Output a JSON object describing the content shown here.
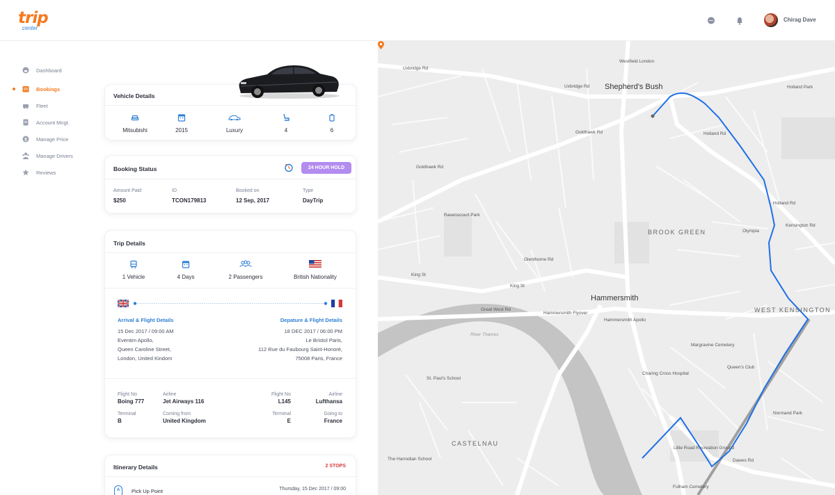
{
  "app": {
    "logo_main": "trip",
    "logo_sub": "center"
  },
  "header": {
    "user_name": "Chirag Dave",
    "icons": [
      "chat-icon",
      "bell-icon"
    ]
  },
  "sidebar": {
    "items": [
      {
        "label": "Dashboard",
        "icon": "dashboard-icon"
      },
      {
        "label": "Bookings",
        "icon": "bookings-icon",
        "active": true
      },
      {
        "label": "Fleet",
        "icon": "fleet-icon"
      },
      {
        "label": "Account Mngt.",
        "icon": "account-icon"
      },
      {
        "label": "Manage Price",
        "icon": "price-icon"
      },
      {
        "label": "Manage Drivers",
        "icon": "drivers-icon"
      },
      {
        "label": "Reviews",
        "icon": "star-icon"
      }
    ]
  },
  "vehicle": {
    "title": "Vehicle Details",
    "stats": [
      {
        "icon": "car-icon",
        "value": "Mitsubishi"
      },
      {
        "icon": "calendar-icon",
        "value": "2015"
      },
      {
        "icon": "car-type-icon",
        "value": "Luxury"
      },
      {
        "icon": "seat-icon",
        "value": "4"
      },
      {
        "icon": "luggage-icon",
        "value": "6"
      }
    ]
  },
  "booking": {
    "title": "Booking Status",
    "hold_badge": "24 HOUR HOLD",
    "amount_label": "Amount Paid",
    "amount": "$250",
    "id_label": "ID",
    "id": "TCON179813",
    "booked_label": "Booked on",
    "booked": "12 Sep, 2017",
    "type_label": "Type",
    "type": "DayTrip"
  },
  "trip": {
    "title": "Trip Details",
    "stats": [
      {
        "icon": "bus-icon",
        "value": "1 Vehicle"
      },
      {
        "icon": "calendar-icon",
        "value": "4 Days"
      },
      {
        "icon": "passengers-icon",
        "value": "2 Passengers"
      },
      {
        "icon": "us-flag-icon",
        "value": "British Nationality"
      }
    ],
    "arrival": {
      "heading": "Arrival & Flight Details",
      "datetime": "15 Dec 2017  /  09:00 AM",
      "line1": "Eventim Apollo,",
      "line2": "Queen Caroline Street,",
      "line3": "London, United Kindom"
    },
    "departure": {
      "heading": "Depature & Flight Details",
      "datetime": "18 DEC 2017  /  06:00 PM",
      "line1": "Le Bristol Paris,",
      "line2": "112 Rue du Faubourg Saint-Honoré,",
      "line3": "75008 Paris, France"
    },
    "flights": {
      "flight_no_label": "Flight No",
      "airline_label": "Airline",
      "terminal_label": "Terminal",
      "coming_label": "Coming from",
      "going_label": "Going to",
      "arr_flight_no": "Boing 777",
      "arr_airline": "Jet Airways 116",
      "arr_terminal": "B",
      "arr_coming": "United Kingdom",
      "dep_flight_no": "L145",
      "dep_airline": "Lufthansa",
      "dep_terminal": "E",
      "dep_going": "France"
    }
  },
  "itinerary": {
    "title": "Itinerary Details",
    "stops": "2 STOPS",
    "first_marker": "A",
    "first_label": "Pick Up Point",
    "first_datetime": "Thursday, 15 Dec 2017  /  09:00"
  },
  "map": {
    "labels": {
      "shepherds_bush": "Shepherd's Bush",
      "hammersmith": "Hammersmith",
      "brook_green": "BROOK GREEN",
      "west_kensington": "WEST KENSINGTON",
      "castelnau": "CASTELNAU",
      "river_thames": "River Thames",
      "uxbridge_rd": "Uxbridge Rd",
      "goldhawk_rd": "Goldhawk Rd",
      "king_st": "King St",
      "great_west_rd": "Great West Rd",
      "hammersmith_flyover": "Hammersmith Flyover",
      "glenthorne_rd": "Glenthorne Rd",
      "holland_rd": "Holland Rd",
      "kensington_rd": "Kensington Rd",
      "olympia": "Olympia",
      "st_pauls_school": "St. Paul's School",
      "ravenscourt_park": "Ravenscourt Park",
      "westfield_london": "Westfield London",
      "fulham_cemetery": "Fulham Cemetery",
      "margravine_cemetery": "Margravine Cemetery",
      "charing_cross_hospital": "Charing Cross Hospital",
      "the_harrodian_school": "The Harrodian School",
      "dawes_rd": "Dawes Rd",
      "holland_park": "Holland Park",
      "hammersmith_apollo": "Hammersmith Apollo",
      "lillie_road_rec": "Lillie Road Recreation Ground",
      "normand_park": "Normand Park",
      "queens_club": "Queen's Club"
    }
  }
}
